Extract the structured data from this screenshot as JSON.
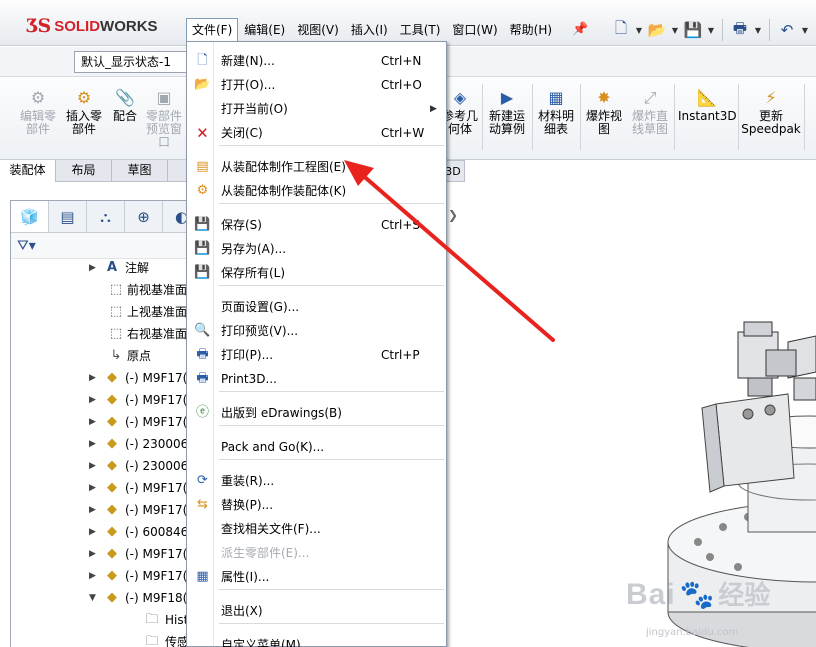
{
  "app": {
    "logo_ds": "ƷS",
    "logo_solid": "SOLID",
    "logo_works": "WORKS"
  },
  "menubar": {
    "items": [
      "文件(F)",
      "编辑(E)",
      "视图(V)",
      "插入(I)",
      "工具(T)",
      "窗口(W)",
      "帮助(H)"
    ]
  },
  "display_state": "默认_显示状态-1",
  "commands": {
    "edit_part": "编辑零\n部件",
    "insert_part": "插入零\n部件",
    "mate": "配合",
    "part_preview": "零部件\n预览窗\n口",
    "ref_geometry": "参考几\n何体",
    "motion_study": "新建运\n动算例",
    "bom": "材料明\n细表",
    "exploded_view": "爆炸视\n图",
    "explode_line": "爆炸直\n线草图",
    "instant3d": "Instant3D",
    "update_speedpak": "更新\nSpeedpak"
  },
  "tabs": [
    "装配体",
    "布局",
    "草图"
  ],
  "tab_3d": "3D",
  "tree": [
    {
      "label": "注解",
      "icon": "annotation-icon",
      "expand": "▶"
    },
    {
      "label": "前视基准面",
      "icon": "plane-icon",
      "expand": ""
    },
    {
      "label": "上视基准面",
      "icon": "plane-icon",
      "expand": ""
    },
    {
      "label": "右视基准面",
      "icon": "plane-icon",
      "expand": ""
    },
    {
      "label": "原点",
      "icon": "origin-icon",
      "expand": ""
    },
    {
      "label": "(-) M9F17(",
      "icon": "part-icon",
      "expand": "▶"
    },
    {
      "label": "(-) M9F17(",
      "icon": "part-icon",
      "expand": "▶"
    },
    {
      "label": "(-) M9F17(",
      "icon": "part-icon",
      "expand": "▶"
    },
    {
      "label": "(-) 230006",
      "icon": "part-icon",
      "expand": "▶"
    },
    {
      "label": "(-) 230006",
      "icon": "part-icon",
      "expand": "▶"
    },
    {
      "label": "(-) M9F17(",
      "icon": "part-icon",
      "expand": "▶"
    },
    {
      "label": "(-) M9F17(",
      "icon": "part-icon",
      "expand": "▶"
    },
    {
      "label": "(-) 600846",
      "icon": "part-icon",
      "expand": "▶"
    },
    {
      "label": "(-) M9F17(",
      "icon": "part-icon",
      "expand": "▶"
    },
    {
      "label": "(-) M9F17(",
      "icon": "part-icon",
      "expand": "▶"
    },
    {
      "label": "(-) M9F18(",
      "icon": "part-icon",
      "expand": "▼"
    },
    {
      "label": "Histor",
      "icon": "history-icon",
      "expand": ""
    },
    {
      "label": "传感器",
      "icon": "sensor-icon",
      "expand": ""
    }
  ],
  "file_menu": {
    "items": [
      {
        "label": "新建(N)...",
        "shortcut": "Ctrl+N",
        "icon": "new-document-icon"
      },
      {
        "label": "打开(O)...",
        "shortcut": "Ctrl+O",
        "icon": "open-folder-icon"
      },
      {
        "label": "打开当前(O)",
        "shortcut": "",
        "icon": ""
      },
      {
        "label": "关闭(C)",
        "shortcut": "Ctrl+W",
        "icon": "close-document-icon"
      },
      {
        "label": "从装配体制作工程图(E)",
        "shortcut": "",
        "icon": "make-drawing-icon"
      },
      {
        "label": "从装配体制作装配体(K)",
        "shortcut": "",
        "icon": "make-assembly-icon"
      },
      {
        "label": "保存(S)",
        "shortcut": "Ctrl+S",
        "icon": "save-icon"
      },
      {
        "label": "另存为(A)...",
        "shortcut": "",
        "icon": "save-as-icon"
      },
      {
        "label": "保存所有(L)",
        "shortcut": "",
        "icon": "save-all-icon"
      },
      {
        "label": "页面设置(G)...",
        "shortcut": "",
        "icon": ""
      },
      {
        "label": "打印预览(V)...",
        "shortcut": "",
        "icon": "print-preview-icon"
      },
      {
        "label": "打印(P)...",
        "shortcut": "Ctrl+P",
        "icon": "print-icon"
      },
      {
        "label": "Print3D...",
        "shortcut": "",
        "icon": "print3d-icon"
      },
      {
        "label": "出版到 eDrawings(B)",
        "shortcut": "",
        "icon": "edrawings-icon"
      },
      {
        "label": "Pack and Go(K)...",
        "shortcut": "",
        "icon": ""
      },
      {
        "label": "重装(R)...",
        "shortcut": "",
        "icon": "reload-icon"
      },
      {
        "label": "替换(P)...",
        "shortcut": "",
        "icon": "replace-icon"
      },
      {
        "label": "查找相关文件(F)...",
        "shortcut": "",
        "icon": ""
      },
      {
        "label": "派生零部件(E)...",
        "shortcut": "",
        "icon": ""
      },
      {
        "label": "属性(I)...",
        "shortcut": "",
        "icon": "properties-icon"
      },
      {
        "label": "退出(X)",
        "shortcut": "",
        "icon": ""
      },
      {
        "label": "自定义菜单(M)",
        "shortcut": "",
        "icon": ""
      }
    ]
  },
  "watermark": {
    "text": "Bai",
    "text2": "经验",
    "url": "jingyan.baidu.com"
  },
  "colors": {
    "accent": "#d3222a",
    "arrow": "#e8231e"
  }
}
